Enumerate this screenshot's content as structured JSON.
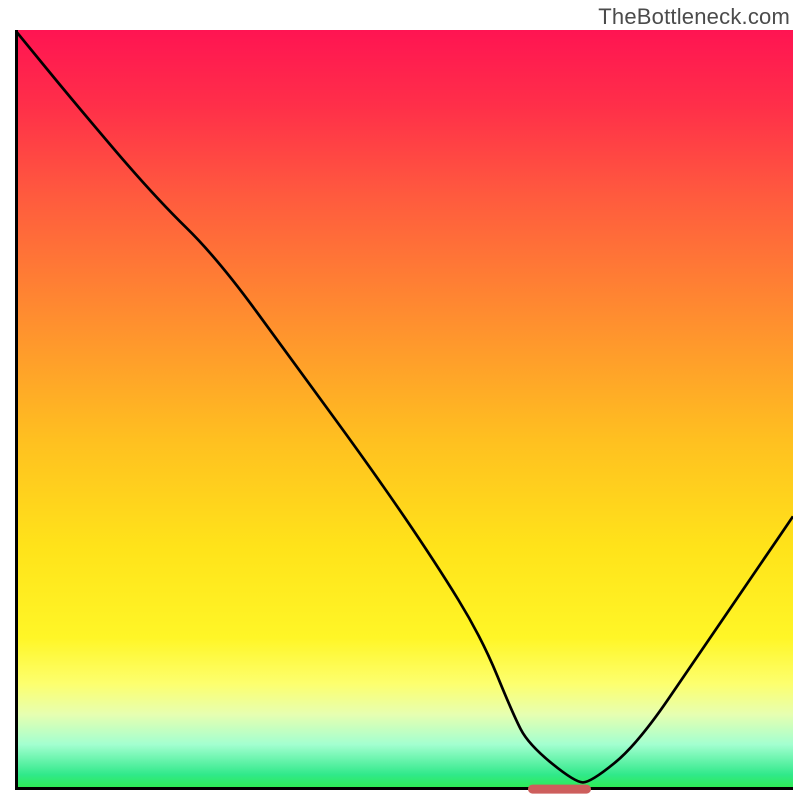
{
  "watermark": "TheBottleneck.com",
  "chart_data": {
    "type": "line",
    "title": "",
    "xlabel": "",
    "ylabel": "",
    "x_range": [
      0,
      100
    ],
    "y_range": [
      0,
      100
    ],
    "series": [
      {
        "name": "bottleneck-curve",
        "x": [
          0,
          8,
          18,
          26,
          36,
          46,
          54,
          60,
          64,
          66,
          72,
          74,
          80,
          88,
          96,
          100
        ],
        "values": [
          100,
          90,
          78,
          70,
          56,
          42,
          30,
          20,
          10,
          6,
          1,
          1,
          6,
          18,
          30,
          36
        ]
      }
    ],
    "gradient_stops": [
      {
        "pos": 0.0,
        "color": "#ff1452"
      },
      {
        "pos": 0.1,
        "color": "#ff2f49"
      },
      {
        "pos": 0.22,
        "color": "#ff5b3e"
      },
      {
        "pos": 0.38,
        "color": "#ff8e2f"
      },
      {
        "pos": 0.54,
        "color": "#ffc020"
      },
      {
        "pos": 0.68,
        "color": "#ffe31a"
      },
      {
        "pos": 0.8,
        "color": "#fff627"
      },
      {
        "pos": 0.86,
        "color": "#fdff6e"
      },
      {
        "pos": 0.9,
        "color": "#e7ffb0"
      },
      {
        "pos": 0.94,
        "color": "#a3ffd0"
      },
      {
        "pos": 0.98,
        "color": "#30e98a"
      },
      {
        "pos": 1.0,
        "color": "#2eeb4a"
      }
    ],
    "optimal_marker": {
      "x_start": 66,
      "x_end": 74,
      "color": "#cd5e5c"
    }
  }
}
